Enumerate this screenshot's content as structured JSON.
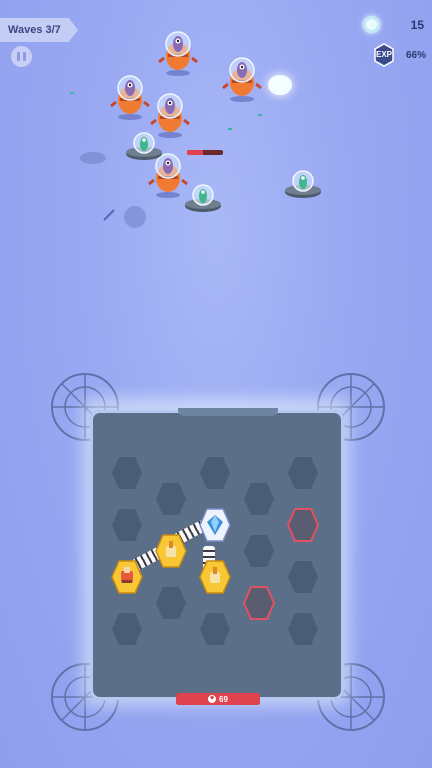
{
  "hud": {
    "waves_label": "Waves 3/7",
    "coins": "15",
    "exp_badge": "EXP",
    "exp_percent": "66%"
  },
  "board": {
    "base_hp": "69",
    "base_hp_fraction": 1.0
  },
  "enemies": {
    "target_hp_fraction": 0.45
  },
  "colors": {
    "background": "#98a8f2",
    "board": "#5b6f88",
    "empty_cell": "#4b5d74",
    "blocked_cell": "#e05261",
    "turret_cell": "#f7c735",
    "core_cell": "#3f8fd8",
    "hp_red": "#e0424e"
  }
}
